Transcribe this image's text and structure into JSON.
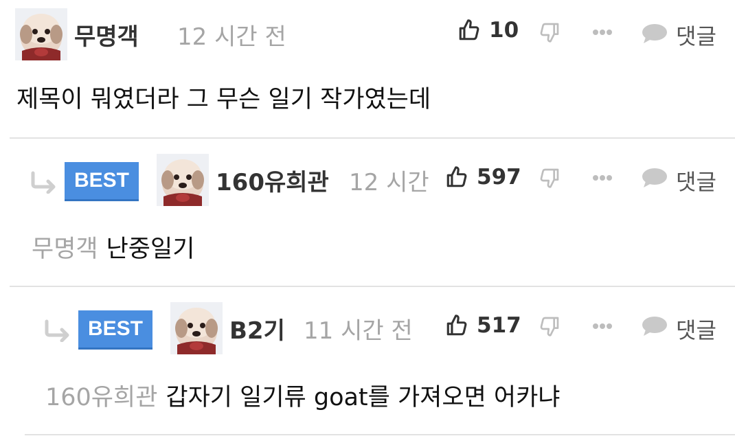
{
  "comments": [
    {
      "nickname": "무명객",
      "time": "12 시간 전",
      "likes": "10",
      "reply_label": "댓글",
      "body": "제목이 뭐였더라 그 무슨 일기 작가였는데"
    },
    {
      "badge": "BEST",
      "nickname": "160유희관",
      "time": "12 시간",
      "likes": "597",
      "reply_label": "댓글",
      "mention": "무명객",
      "body": "난중일기"
    },
    {
      "badge": "BEST",
      "nickname": "B2기",
      "time": "11 시간 전",
      "likes": "517",
      "reply_label": "댓글",
      "mention": "160유희관",
      "body": "갑자기 일기류 goat를 가져오면 어카냐"
    }
  ],
  "colors": {
    "best_badge": "#4a8ee0",
    "muted_text": "#a5a5a5",
    "divider": "#e2e2e2"
  },
  "icons": [
    "avatar-puppy",
    "thumbs-up-icon",
    "thumbs-down-icon",
    "more-dots-icon",
    "speech-bubble-icon",
    "reply-arrow-icon"
  ]
}
